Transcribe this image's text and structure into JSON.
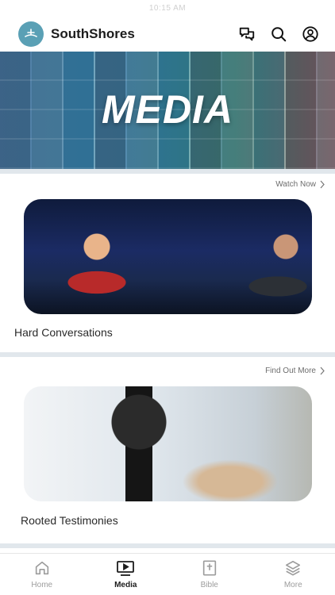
{
  "app": {
    "brand": "SouthShores",
    "status_text": "10:15 AM"
  },
  "hero": {
    "title": "MEDIA"
  },
  "cards": [
    {
      "cta": "Watch Now",
      "title": "Hard Conversations"
    },
    {
      "cta": "Find Out More",
      "title": "Rooted Testimonies"
    }
  ],
  "nav": {
    "items": [
      {
        "label": "Home",
        "icon": "home-icon"
      },
      {
        "label": "Media",
        "icon": "media-play-icon",
        "active": true
      },
      {
        "label": "Bible",
        "icon": "bible-icon"
      },
      {
        "label": "More",
        "icon": "layers-icon"
      }
    ]
  },
  "colors": {
    "accent": "#5aa0b5",
    "separator": "#e1e7ec",
    "text_dark": "#1c1c1c",
    "text_muted": "#9c9c9c"
  }
}
